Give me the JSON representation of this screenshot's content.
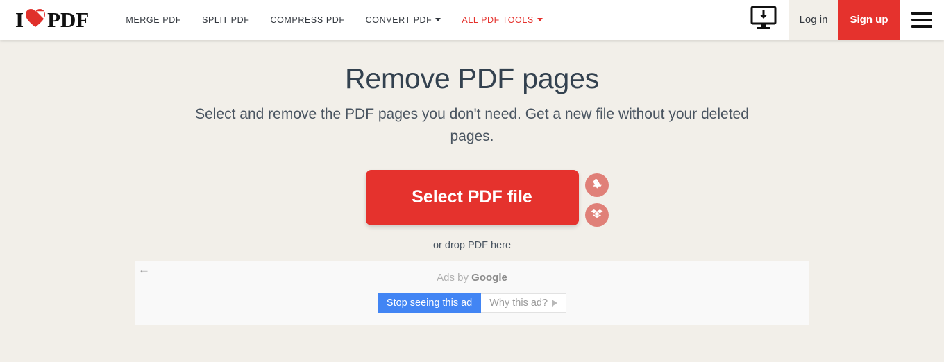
{
  "brand": {
    "name": "I♥PDF",
    "text_before": "I",
    "text_after": "PDF",
    "heart_icon": "heart-icon",
    "accent_color": "#e5322d"
  },
  "header": {
    "nav": [
      {
        "label": "MERGE PDF",
        "has_caret": false,
        "accent": false
      },
      {
        "label": "SPLIT PDF",
        "has_caret": false,
        "accent": false
      },
      {
        "label": "COMPRESS PDF",
        "has_caret": false,
        "accent": false
      },
      {
        "label": "CONVERT PDF",
        "has_caret": true,
        "accent": false
      },
      {
        "label": "ALL PDF TOOLS",
        "has_caret": true,
        "accent": true
      }
    ],
    "desktop_icon": "desktop-download-icon",
    "login_label": "Log in",
    "signup_label": "Sign up",
    "menu_icon": "hamburger-menu-icon"
  },
  "main": {
    "title": "Remove PDF pages",
    "subtitle": "Select and remove the PDF pages you don't need. Get a new file without your deleted pages.",
    "select_button": "Select PDF file",
    "drop_hint": "or drop PDF here",
    "cloud_buttons": [
      {
        "name": "google-drive-icon",
        "label": "Google Drive"
      },
      {
        "name": "dropbox-icon",
        "label": "Dropbox"
      }
    ]
  },
  "ad": {
    "back_icon": "back-arrow-icon",
    "label_prefix": "Ads by",
    "label_brand": "Google",
    "stop_label": "Stop seeing this ad",
    "why_label": "Why this ad?",
    "why_icon": "play-triangle-icon"
  },
  "colors": {
    "page_background": "#f2efe9",
    "header_background": "#ffffff",
    "accent_red": "#e5322d",
    "title_color": "#33414f",
    "ad_background": "#f9f9f9",
    "ad_button_blue": "#4285f4",
    "cloud_button": "#e08078"
  }
}
